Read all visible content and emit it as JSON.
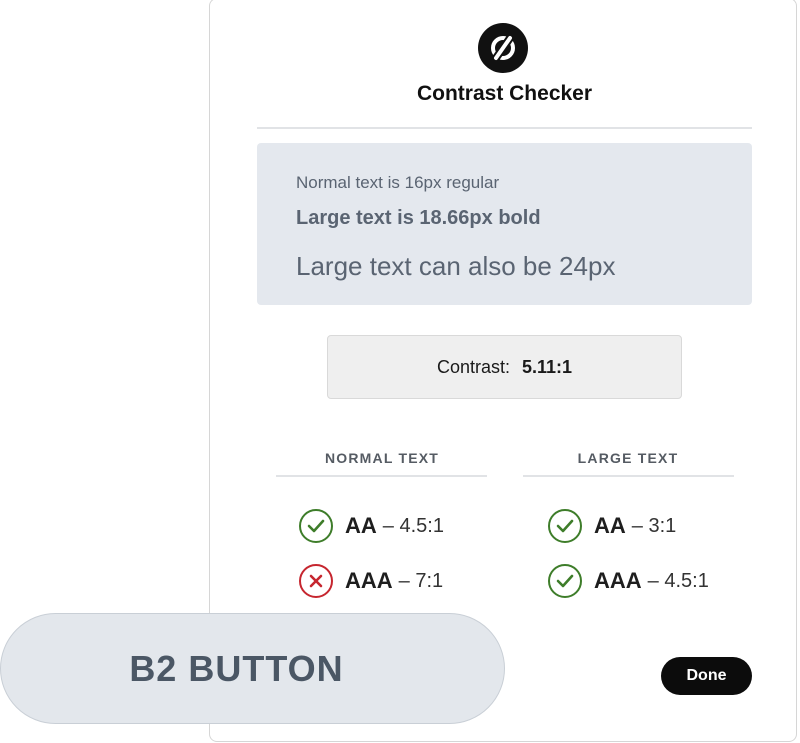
{
  "header": {
    "logo_icon": "contrast-logo-icon",
    "title": "Contrast Checker"
  },
  "preview": {
    "normal_text": "Normal text is 16px regular",
    "large_bold_text": "Large text is 18.66px bold",
    "large_text": "Large text can also be 24px"
  },
  "contrast": {
    "label": "Contrast:",
    "value": "5.11:1"
  },
  "normal": {
    "heading": "NORMAL TEXT",
    "results": [
      {
        "level": "AA",
        "ratio": "– 4.5:1",
        "status": "pass"
      },
      {
        "level": "AAA",
        "ratio": "– 7:1",
        "status": "fail"
      }
    ]
  },
  "large": {
    "heading": "LARGE TEXT",
    "results": [
      {
        "level": "AA",
        "ratio": "– 3:1",
        "status": "pass"
      },
      {
        "level": "AAA",
        "ratio": "– 4.5:1",
        "status": "pass"
      }
    ]
  },
  "overlay": {
    "label": "B2 BUTTON"
  },
  "footer": {
    "done_label": "Done"
  },
  "colors": {
    "pass": "#3e7d2a",
    "fail": "#c6262f",
    "preview_bg": "#e4e8ee",
    "preview_text": "#5a6472"
  }
}
